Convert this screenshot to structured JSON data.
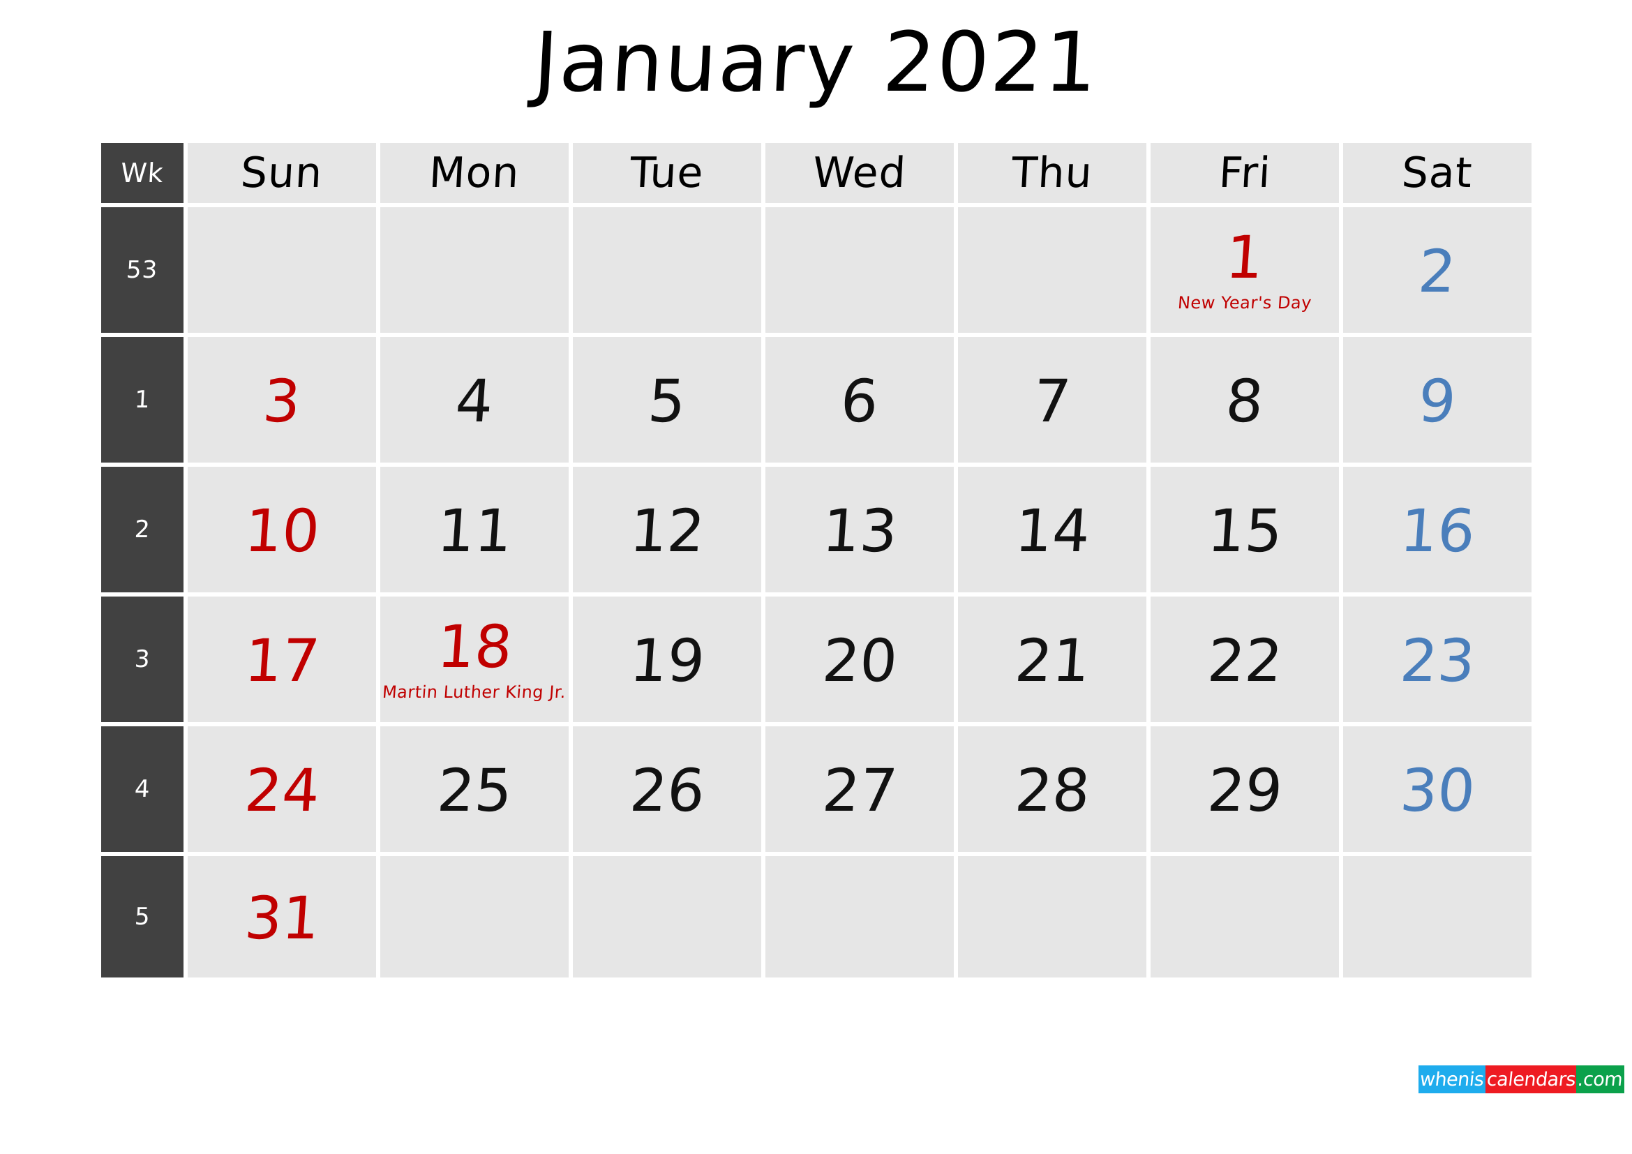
{
  "title": "January 2021",
  "header": {
    "week_label": "Wk",
    "days": [
      "Sun",
      "Mon",
      "Tue",
      "Wed",
      "Thu",
      "Fri",
      "Sat"
    ]
  },
  "colors": {
    "sunday": "#c00000",
    "saturday": "#4a7ebb",
    "weekday": "#111111",
    "holiday": "#c00000",
    "cell_bg": "#e6e6e6",
    "week_col_bg": "#414141",
    "page_bg": "#ffffff"
  },
  "weeks": [
    {
      "week_number": "53",
      "days": [
        {
          "num": "",
          "kind": "empty",
          "holiday": ""
        },
        {
          "num": "",
          "kind": "empty",
          "holiday": ""
        },
        {
          "num": "",
          "kind": "empty",
          "holiday": ""
        },
        {
          "num": "",
          "kind": "empty",
          "holiday": ""
        },
        {
          "num": "",
          "kind": "empty",
          "holiday": ""
        },
        {
          "num": "1",
          "kind": "holiday",
          "holiday": "New Year's Day"
        },
        {
          "num": "2",
          "kind": "sat",
          "holiday": ""
        }
      ]
    },
    {
      "week_number": "1",
      "days": [
        {
          "num": "3",
          "kind": "sun",
          "holiday": ""
        },
        {
          "num": "4",
          "kind": "weekday",
          "holiday": ""
        },
        {
          "num": "5",
          "kind": "weekday",
          "holiday": ""
        },
        {
          "num": "6",
          "kind": "weekday",
          "holiday": ""
        },
        {
          "num": "7",
          "kind": "weekday",
          "holiday": ""
        },
        {
          "num": "8",
          "kind": "weekday",
          "holiday": ""
        },
        {
          "num": "9",
          "kind": "sat",
          "holiday": ""
        }
      ]
    },
    {
      "week_number": "2",
      "days": [
        {
          "num": "10",
          "kind": "sun",
          "holiday": ""
        },
        {
          "num": "11",
          "kind": "weekday",
          "holiday": ""
        },
        {
          "num": "12",
          "kind": "weekday",
          "holiday": ""
        },
        {
          "num": "13",
          "kind": "weekday",
          "holiday": ""
        },
        {
          "num": "14",
          "kind": "weekday",
          "holiday": ""
        },
        {
          "num": "15",
          "kind": "weekday",
          "holiday": ""
        },
        {
          "num": "16",
          "kind": "sat",
          "holiday": ""
        }
      ]
    },
    {
      "week_number": "3",
      "days": [
        {
          "num": "17",
          "kind": "sun",
          "holiday": ""
        },
        {
          "num": "18",
          "kind": "holiday",
          "holiday": "Martin Luther King Jr."
        },
        {
          "num": "19",
          "kind": "weekday",
          "holiday": ""
        },
        {
          "num": "20",
          "kind": "weekday",
          "holiday": ""
        },
        {
          "num": "21",
          "kind": "weekday",
          "holiday": ""
        },
        {
          "num": "22",
          "kind": "weekday",
          "holiday": ""
        },
        {
          "num": "23",
          "kind": "sat",
          "holiday": ""
        }
      ]
    },
    {
      "week_number": "4",
      "days": [
        {
          "num": "24",
          "kind": "sun",
          "holiday": ""
        },
        {
          "num": "25",
          "kind": "weekday",
          "holiday": ""
        },
        {
          "num": "26",
          "kind": "weekday",
          "holiday": ""
        },
        {
          "num": "27",
          "kind": "weekday",
          "holiday": ""
        },
        {
          "num": "28",
          "kind": "weekday",
          "holiday": ""
        },
        {
          "num": "29",
          "kind": "weekday",
          "holiday": ""
        },
        {
          "num": "30",
          "kind": "sat",
          "holiday": ""
        }
      ]
    },
    {
      "week_number": "5",
      "days": [
        {
          "num": "31",
          "kind": "sun",
          "holiday": ""
        },
        {
          "num": "",
          "kind": "empty",
          "holiday": ""
        },
        {
          "num": "",
          "kind": "empty",
          "holiday": ""
        },
        {
          "num": "",
          "kind": "empty",
          "holiday": ""
        },
        {
          "num": "",
          "kind": "empty",
          "holiday": ""
        },
        {
          "num": "",
          "kind": "empty",
          "holiday": ""
        },
        {
          "num": "",
          "kind": "empty",
          "holiday": ""
        }
      ]
    }
  ],
  "logo": {
    "segments": [
      {
        "text": "whenis",
        "color": "#1eaced"
      },
      {
        "text": "calendars",
        "color": "#ee1b22"
      },
      {
        "text": ".com",
        "color": "#0ba14b"
      }
    ]
  }
}
